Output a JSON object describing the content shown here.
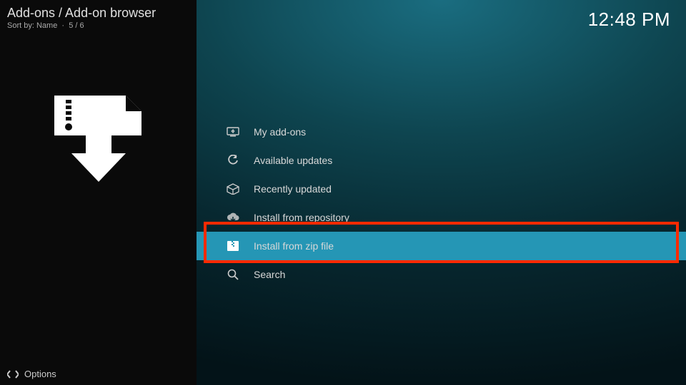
{
  "header": {
    "breadcrumb": "Add-ons / Add-on browser",
    "sort_label": "Sort by:",
    "sort_value": "Name",
    "position": "5 / 6"
  },
  "clock": "12:48 PM",
  "menu": {
    "items": [
      {
        "label": "My add-ons",
        "icon": "screen-icon"
      },
      {
        "label": "Available updates",
        "icon": "refresh-icon"
      },
      {
        "label": "Recently updated",
        "icon": "box-icon"
      },
      {
        "label": "Install from repository",
        "icon": "cloud-down-icon"
      },
      {
        "label": "Install from zip file",
        "icon": "zip-icon",
        "selected": true
      },
      {
        "label": "Search",
        "icon": "search-icon"
      }
    ]
  },
  "footer": {
    "options_label": "Options"
  }
}
